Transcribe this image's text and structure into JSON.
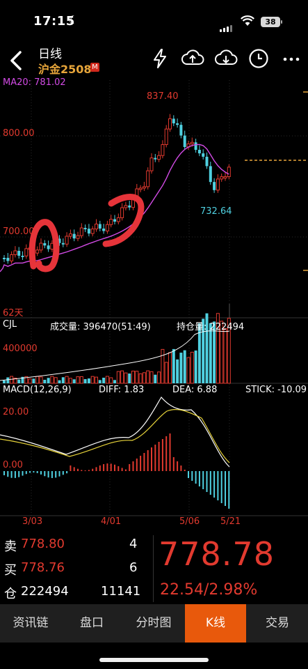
{
  "status_bar": {
    "time": "17:15",
    "battery": "38"
  },
  "header": {
    "title": "日线",
    "symbol": "沪金2508",
    "badge": "M"
  },
  "chart": {
    "ma_label": "MA20: 781.02",
    "high_label": "837.40",
    "low_label": "732.64",
    "y_label_800": "800.00",
    "y_label_700": "700.00",
    "days_label": "62天",
    "volume": {
      "title": "CJL",
      "volume_text": "成交量: 396470(51:49)",
      "oi_text": "持仓量: 222494",
      "y_label": "400000"
    },
    "macd": {
      "title": "MACD(12,26,9)",
      "diff": "DIFF: 1.83",
      "dea": "DEA: 6.88",
      "stick": "STICK: -10.09",
      "y_top": "20.00",
      "y_zero": "0.00"
    },
    "dates": [
      "3/03",
      "4/01",
      "5/06",
      "5/21"
    ],
    "colors": {
      "up": "#e23a2f",
      "down": "#4fd0e0",
      "ma": "#d34be6",
      "background": "#000000"
    }
  },
  "chart_data": {
    "type": "candlestick",
    "ma20_last": 781.02,
    "high": 837.4,
    "low": 732.64,
    "y_ticks": [
      700.0,
      800.0
    ],
    "x_ticks": [
      "3/03",
      "4/01",
      "5/06",
      "5/21"
    ],
    "volume_tick": 400000,
    "macd": {
      "diff": 1.83,
      "dea": 6.88,
      "stick": -10.09,
      "ticks": [
        0.0,
        20.0
      ]
    }
  },
  "quote": {
    "sell_label": "卖",
    "sell_price": "778.80",
    "sell_qty": "4",
    "buy_label": "买",
    "buy_price": "778.76",
    "buy_qty": "6",
    "oi_label": "仓",
    "oi_value": "222494",
    "oi_change": "11141",
    "last_price": "778.78",
    "change": "22.54/2.98%"
  },
  "tabs": [
    {
      "label": "资讯链"
    },
    {
      "label": "盘口"
    },
    {
      "label": "分时图"
    },
    {
      "label": "K线"
    },
    {
      "label": "交易"
    }
  ]
}
